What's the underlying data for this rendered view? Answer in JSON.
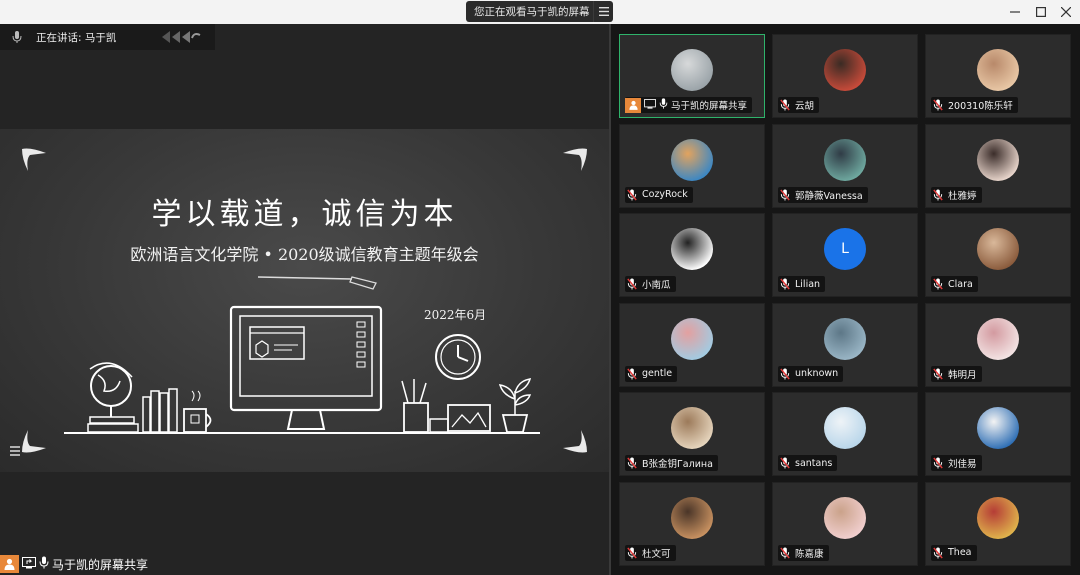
{
  "topbar": {
    "viewing_text": "您正在观看马于凯的屏幕"
  },
  "speaking": {
    "text": "正在讲话: 马于凯"
  },
  "slide": {
    "title": "学以载道，诚信为本",
    "subtitle": "欧洲语言文化学院 • 2020级诚信教育主题年级会",
    "date": "2022年6月"
  },
  "share_bar": {
    "label": "马于凯的屏幕共享"
  },
  "participants": [
    {
      "name": "马于凯的屏幕共享",
      "active": true
    },
    {
      "name": "云胡"
    },
    {
      "name": "200310陈乐轩"
    },
    {
      "name": "CozyRock"
    },
    {
      "name": "郭静薇Vanessa"
    },
    {
      "name": "杜雅婷"
    },
    {
      "name": "小南瓜"
    },
    {
      "name": "Lilian",
      "letter": "L"
    },
    {
      "name": "Clara"
    },
    {
      "name": "gentle"
    },
    {
      "name": "unknown"
    },
    {
      "name": "韩明月"
    },
    {
      "name": "B张金钥Галина"
    },
    {
      "name": "santans"
    },
    {
      "name": "刘佳易"
    },
    {
      "name": "杜文可"
    },
    {
      "name": "陈嘉康"
    },
    {
      "name": "Thea"
    }
  ],
  "colors": {
    "accent_active": "#2fb36b",
    "letter_avatar": "#1a73e8",
    "share_badge": "#e8883a"
  }
}
